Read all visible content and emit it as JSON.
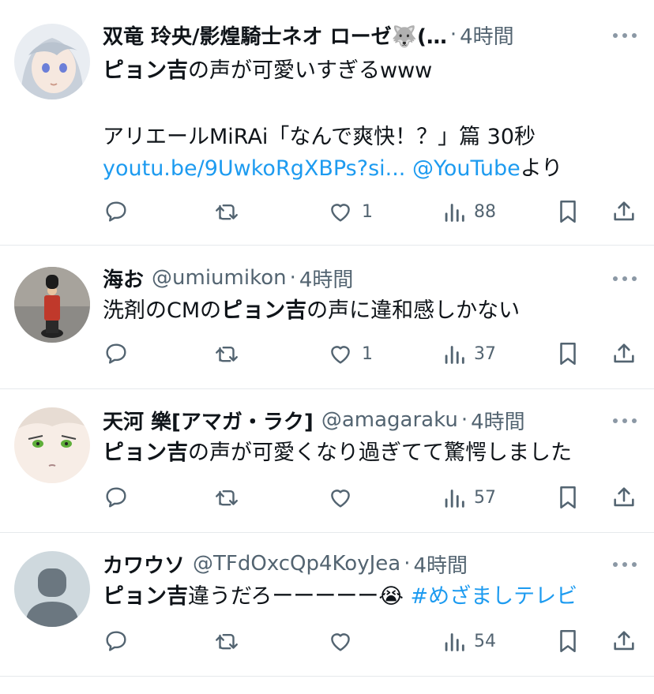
{
  "tweets": [
    {
      "name": "双竜 玲央/影煌騎士ネオ ローゼ🐺(…",
      "handle": "",
      "time": "4時間",
      "lines": [
        [
          {
            "t": "ピョン吉",
            "bold": true
          },
          {
            "t": "の声が可愛いすぎるwww"
          }
        ],
        [],
        [
          {
            "t": "アリエールMiRAi「なんで爽快！？」篇 30秒"
          }
        ],
        [
          {
            "t": "youtu.be/9UwkoRgXBPs?si...",
            "link": true
          },
          {
            "t": " "
          },
          {
            "t": "@YouTube",
            "link": true
          },
          {
            "t": "より"
          }
        ]
      ],
      "likes": "1",
      "views": "88"
    },
    {
      "name": "海お",
      "handle": "@umiumikon",
      "time": "4時間",
      "lines": [
        [
          {
            "t": "洗剤のCMの"
          },
          {
            "t": "ピョン吉",
            "bold": true
          },
          {
            "t": "の声に違和感しかない"
          }
        ]
      ],
      "likes": "1",
      "views": "37"
    },
    {
      "name": "天河 樂[アマガ・ラク]",
      "handle": "@amagaraku",
      "time": "4時間",
      "lines": [
        [
          {
            "t": "ピョン吉",
            "bold": true
          },
          {
            "t": "の声が可愛くなり過ぎてて驚愕しました"
          }
        ]
      ],
      "likes": "",
      "views": "57"
    },
    {
      "name": "カワウソ",
      "handle": "@TFdOxcQp4KoyJea",
      "time": "4時間",
      "lines": [
        [
          {
            "t": "ピョン吉",
            "bold": true
          },
          {
            "t": "違うだろーーーーー😭 "
          },
          {
            "t": "#めざましテレビ",
            "link": true
          }
        ]
      ],
      "likes": "",
      "views": "54"
    }
  ],
  "icons": [
    "reply-icon",
    "retweet-icon",
    "like-icon",
    "views-icon",
    "bookmark-icon",
    "share-icon",
    "more-icon"
  ],
  "colors": {
    "text": "#0f1419",
    "secondary": "#536471",
    "link": "#1d9bf0",
    "divider": "#e6e9ec"
  }
}
